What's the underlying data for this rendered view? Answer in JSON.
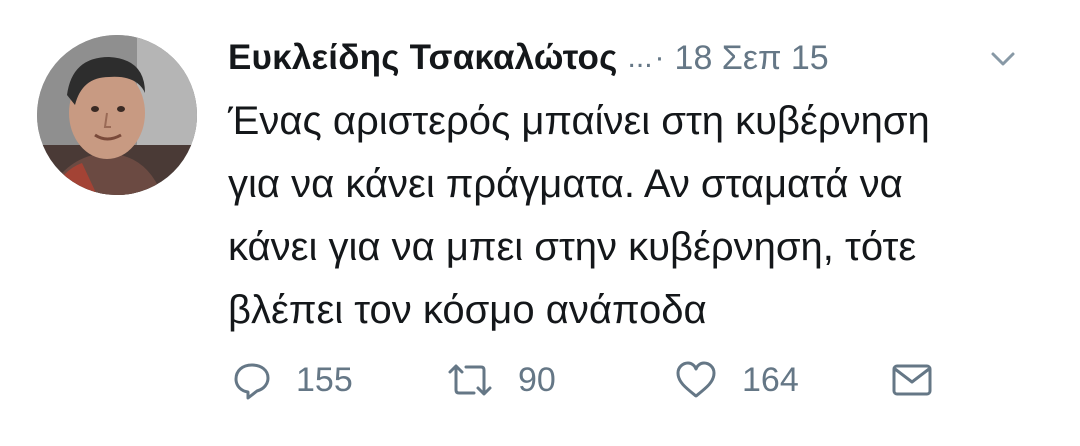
{
  "tweet": {
    "author_name": "Ευκλείδης Τσακαλώτος",
    "handle_truncated": "...",
    "separator": "·",
    "date": "18 Σεπ 15",
    "text_lines": [
      "Ένας αριστερός μπαίνει στη κυβέρνηση",
      "για να κάνει πράγματα. Αν σταματά να",
      "κάνει για να μπει στην κυβέρνηση, τότε",
      "βλέπει τον κόσμο ανάποδα"
    ]
  },
  "actions": {
    "reply_count": "155",
    "retweet_count": "90",
    "like_count": "164"
  },
  "icons": {
    "reply": "speech-bubble-icon",
    "retweet": "retweet-arrows-icon",
    "like": "heart-icon",
    "message": "envelope-icon",
    "menu": "chevron-down-icon"
  },
  "colors": {
    "text": "#14171a",
    "secondary": "#657786",
    "background": "#ffffff"
  }
}
